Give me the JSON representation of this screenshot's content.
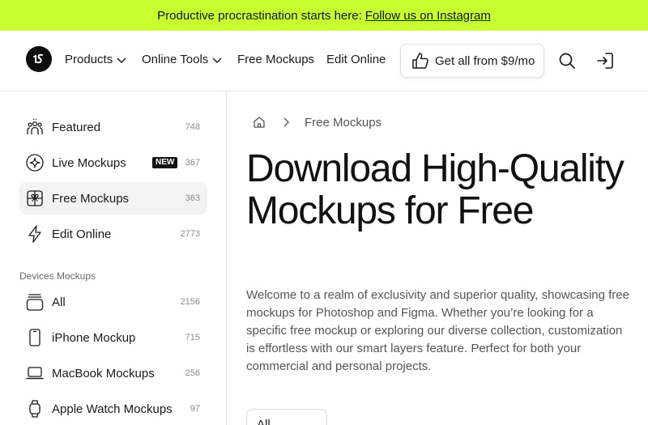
{
  "promo": {
    "text": "Productive procrastination starts here:",
    "link": "Follow us on Instagram",
    "color": "#c8ff2e"
  },
  "header": {
    "logo_icon": "ls-logo-icon",
    "nav": [
      {
        "label": "Products",
        "dropdown": true
      },
      {
        "label": "Online Tools",
        "dropdown": true
      },
      {
        "label": "Free Mockups",
        "dropdown": false
      },
      {
        "label": "Edit Online",
        "dropdown": false
      }
    ],
    "cta": "Get all from $9/mo",
    "icons": [
      "thumbs-up-icon",
      "search-icon",
      "sign-in-icon"
    ]
  },
  "sidebar": {
    "top_items": [
      {
        "label": "Featured",
        "count": "748",
        "icon": "crowd-icon",
        "active": false
      },
      {
        "label": "Live Mockups",
        "count": "367",
        "icon": "sparkle-icon",
        "badge": "NEW",
        "active": false
      },
      {
        "label": "Free Mockups",
        "count": "363",
        "icon": "gift-icon",
        "active": true
      },
      {
        "label": "Edit Online",
        "count": "2773",
        "icon": "lightning-icon",
        "active": false
      }
    ],
    "section_label": "Devices Mockups",
    "device_items": [
      {
        "label": "All",
        "count": "2156",
        "icon": "devices-icon"
      },
      {
        "label": "iPhone Mockup",
        "count": "715",
        "icon": "phone-icon"
      },
      {
        "label": "MacBook Mockups",
        "count": "256",
        "icon": "laptop-icon"
      },
      {
        "label": "Apple Watch Mockups",
        "count": "97",
        "icon": "watch-icon"
      }
    ]
  },
  "main": {
    "breadcrumb": {
      "home_icon": "home-icon",
      "separator_icon": "chevron-right-icon",
      "current": "Free Mockups"
    },
    "title": "Download High-Quality Mockups for Free",
    "description": "Welcome to a realm of exclusivity and superior quality, showcasing free mockups for Photoshop and Figma. Whether you’re looking for a specific free mockup or exploring our diverse collection, customization is effortless with our smart layers feature. Perfect for both your commercial and personal projects.",
    "filter": {
      "value": "All"
    }
  }
}
